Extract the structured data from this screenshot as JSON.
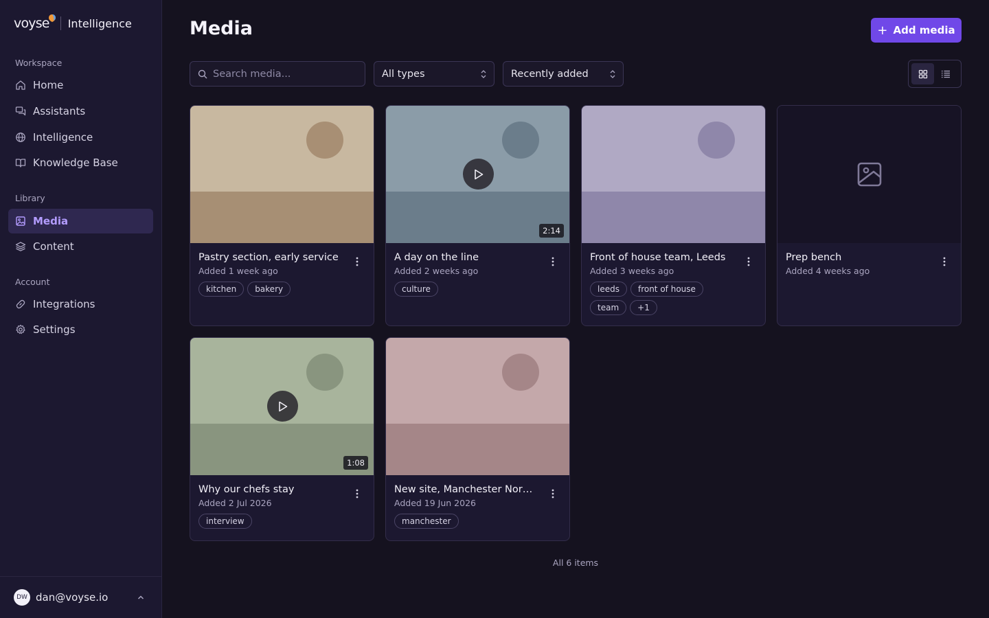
{
  "brand": {
    "logo_text": "voyse",
    "product": "Intelligence"
  },
  "sidebar": {
    "sections": [
      {
        "label": "Workspace",
        "items": [
          {
            "label": "Home",
            "icon": "home-icon"
          },
          {
            "label": "Assistants",
            "icon": "chat-icon"
          },
          {
            "label": "Intelligence",
            "icon": "globe-icon"
          },
          {
            "label": "Knowledge Base",
            "icon": "book-icon"
          }
        ]
      },
      {
        "label": "Library",
        "items": [
          {
            "label": "Media",
            "icon": "image-icon",
            "active": true
          },
          {
            "label": "Content",
            "icon": "layers-icon"
          }
        ]
      },
      {
        "label": "Account",
        "items": [
          {
            "label": "Integrations",
            "icon": "link-icon"
          },
          {
            "label": "Settings",
            "icon": "gear-icon"
          }
        ]
      }
    ],
    "user": {
      "initials": "DW",
      "email": "dan@voyse.io"
    }
  },
  "header": {
    "title": "Media",
    "add_button": "Add media",
    "add_icon": "+"
  },
  "filters": {
    "search_placeholder": "Search media...",
    "type_value": "All types",
    "sort_value": "Recently added",
    "view": "grid"
  },
  "cards": [
    {
      "title": "Pastry section, early service",
      "date": "Added 1 week ago",
      "tags": [
        "kitchen",
        "bakery"
      ],
      "kind": "image"
    },
    {
      "title": "A day on the line",
      "date": "Added 2 weeks ago",
      "tags": [
        "culture"
      ],
      "kind": "video",
      "duration": "2:14"
    },
    {
      "title": "Front of house team, Leeds",
      "date": "Added 3 weeks ago",
      "tags": [
        "leeds",
        "front of house",
        "team",
        "+1"
      ],
      "kind": "image"
    },
    {
      "title": "Prep bench",
      "date": "Added 4 weeks ago",
      "tags": [],
      "kind": "placeholder"
    },
    {
      "title": "Why our chefs stay",
      "date": "Added 2 Jul 2026",
      "tags": [
        "interview"
      ],
      "kind": "video",
      "duration": "1:08"
    },
    {
      "title": "New site, Manchester Nort...",
      "date": "Added 19 Jun 2026",
      "tags": [
        "manchester"
      ],
      "kind": "image"
    }
  ],
  "colors": {
    "accent": "#7048e8",
    "card1": {
      "sky": "#c8b8a0",
      "ground": "#a78f74",
      "sun": "#a88f74"
    },
    "card2": {
      "sky": "#8b9ca8",
      "ground": "#6b7d8b",
      "sun": "#6b7d8b"
    },
    "card3": {
      "sky": "#b0a9c4",
      "ground": "#8f87aa",
      "sun": "#8f87aa"
    },
    "card5": {
      "sky": "#a8b49c",
      "ground": "#89957f",
      "sun": "#89957f"
    },
    "card6": {
      "sky": "#c4a8aa",
      "ground": "#a58688",
      "sun": "#a58688"
    }
  },
  "footer": {
    "count_text": "All 6 items"
  }
}
